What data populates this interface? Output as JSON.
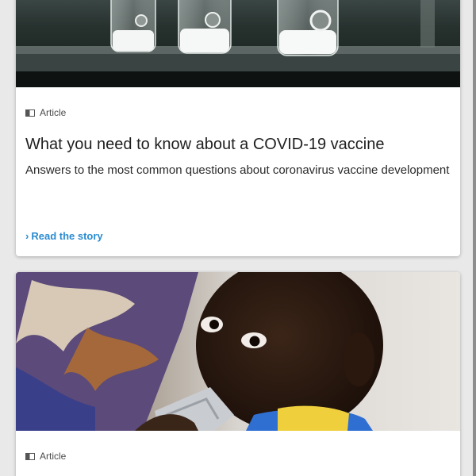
{
  "feed": {
    "cards": [
      {
        "type_icon": "article-icon",
        "type_label": "Article",
        "title": "What you need to know about a COVID-19 vaccine",
        "summary": "Answers to the most common questions about coronavirus vaccine development",
        "cta_icon": "chevron-right-icon",
        "cta_label": "Read the story",
        "image": "vaccine-vials-photo"
      },
      {
        "type_icon": "article-icon",
        "type_label": "Article",
        "image": "child-eating-photo"
      }
    ]
  },
  "colors": {
    "link": "#2a8bd0",
    "card_bg": "#ffffff",
    "page_bg": "#e9e9e9"
  }
}
